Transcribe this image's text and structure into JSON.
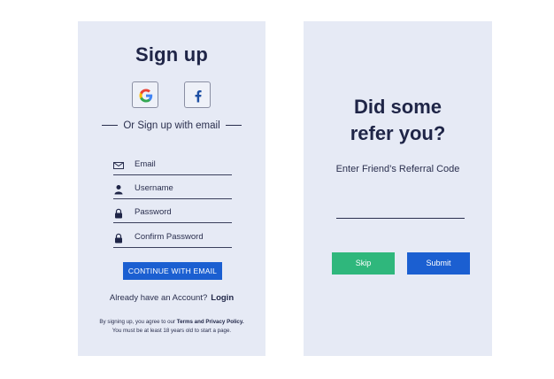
{
  "signup": {
    "title": "Sign up",
    "google_icon": "google-icon",
    "facebook_icon": "facebook-icon",
    "or_text": "Or Sign up with email",
    "fields": [
      {
        "icon": "mail-icon",
        "label": "Email"
      },
      {
        "icon": "user-icon",
        "label": "Username"
      },
      {
        "icon": "lock-icon",
        "label": "Password"
      },
      {
        "icon": "lock-icon",
        "label": "Confirm Password"
      }
    ],
    "continue_label": "CONTINUE WITH EMAIL",
    "login_prompt": "Already have an Account?",
    "login_link": "Login",
    "terms_line1_prefix": "By signing up, you agree to our",
    "terms_link": "Terms and Privacy Policy.",
    "terms_line2": "You must be at least 18 years old to start a page."
  },
  "referral": {
    "title_line1": "Did some",
    "title_line2": "refer you?",
    "prompt": "Enter Friend’s Referral Code",
    "input_value": "",
    "skip_label": "Skip",
    "submit_label": "Submit"
  },
  "colors": {
    "panel_bg": "#e6eaf5",
    "primary": "#1b5fd1",
    "skip_green": "#2fb77c",
    "text_dark": "#1f2547"
  }
}
